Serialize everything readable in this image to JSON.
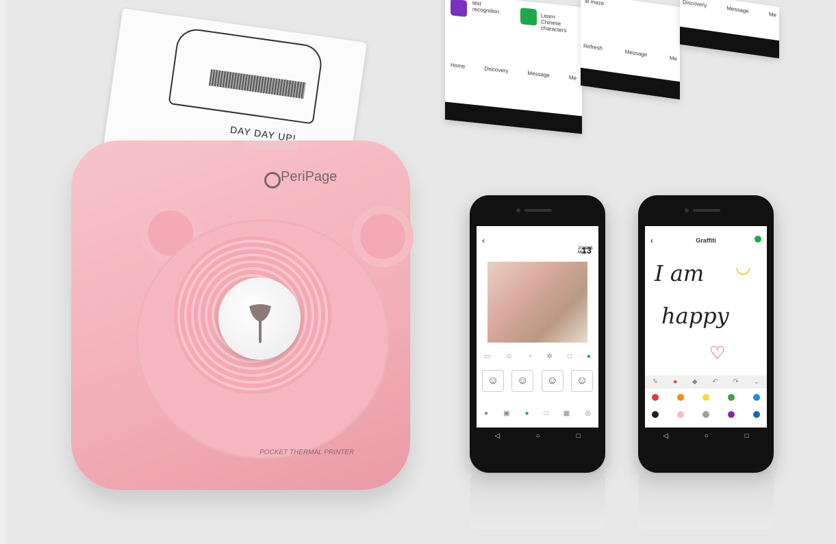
{
  "paper": {
    "caption": "DAY DAY UP!"
  },
  "printer": {
    "brand": "PeriPage",
    "subtitle": "POCKET THERMAL PRINTER",
    "color": "#f3aeb7"
  },
  "top_screens": {
    "card1": {
      "label": "text recognition"
    },
    "card2": {
      "label": "Learn Chinese characters"
    },
    "nav": [
      "Home",
      "Discovery",
      "Message",
      "Me"
    ],
    "middle": {
      "label": "al maze",
      "nav": [
        "Refresh",
        "Message",
        "Me"
      ]
    },
    "right": {
      "nav": [
        "Discovery",
        "Message",
        "Me"
      ]
    }
  },
  "phone_left": {
    "date_day": "13",
    "date_text": "2019/05 Mon"
  },
  "phone_right": {
    "title": "Graffiti",
    "line1": "I am",
    "line2": "happy",
    "colors": [
      "#e53935",
      "#fb8c00",
      "#fdd835",
      "#43a047",
      "#1e88e5",
      "#212121",
      "#f8bbd0",
      "#9e9e9e",
      "#8e24aa",
      "#1565c0"
    ]
  },
  "icons": [
    "back-arrow-icon",
    "check-icon",
    "undo-icon",
    "redo-icon"
  ]
}
